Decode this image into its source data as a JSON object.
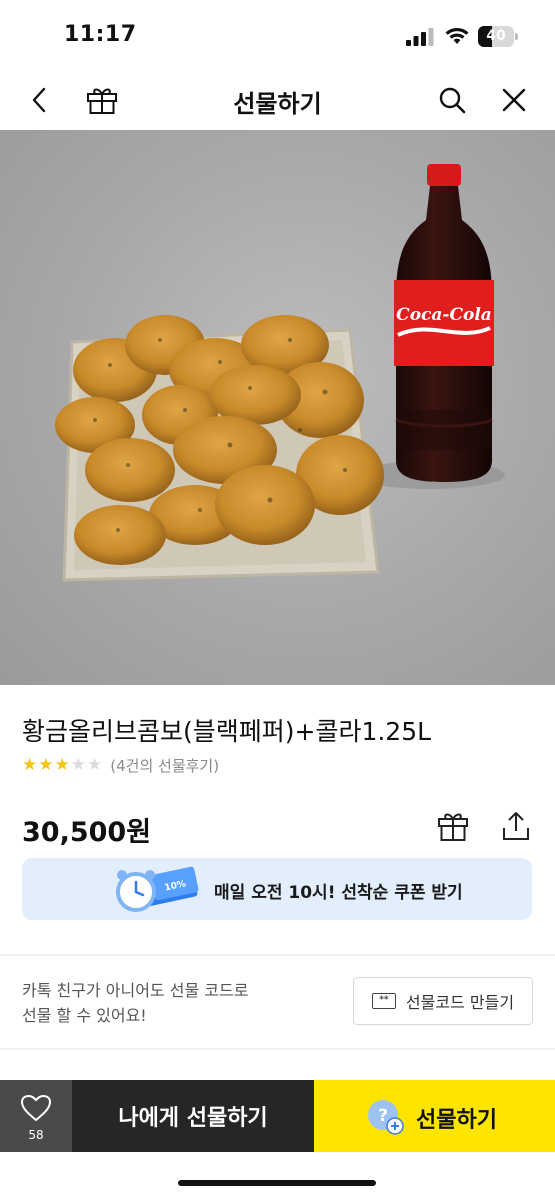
{
  "status_bar": {
    "time": "11:17",
    "battery": "40",
    "battery_level": 0.4
  },
  "nav": {
    "title": "선물하기",
    "back_icon": "chevron-left-icon",
    "gift_icon": "gift-icon",
    "search_icon": "search-icon",
    "close_icon": "close-icon"
  },
  "product": {
    "name": "황금올리브콤보(블랙페퍼)+콜라1.25L",
    "rating_stars": 3,
    "rating_max": 5,
    "review_count": "(4건의 선물후기)",
    "price": "30,500원"
  },
  "coupon": {
    "label": "매일 오전 10시! 선착순 쿠폰 받기"
  },
  "gift_code": {
    "info_line1": "카톡 친구가 아니어도 선물 코드로",
    "info_line2": "선물 할 수 있어요!",
    "button_label": "선물코드 만들기",
    "button_icon_text": "**"
  },
  "bottom_bar": {
    "like_count": "58",
    "self_gift_label": "나에게 선물하기",
    "gift_label": "선물하기"
  },
  "colors": {
    "accent_yellow": "#fee500",
    "dark_button": "#262626",
    "star": "#f5c518",
    "coupon_bg": "#e2eefc"
  }
}
